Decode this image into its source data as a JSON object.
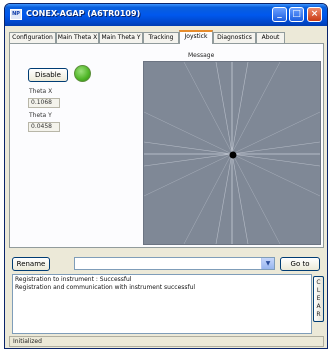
{
  "window": {
    "title": "CONEX-AGAP (A6TR0109)",
    "icon_text": "NP"
  },
  "title_buttons": {
    "minimize": "_",
    "maximize": "□",
    "close": "×"
  },
  "tabs": [
    {
      "label": "Configuration",
      "active": false
    },
    {
      "label": "Main Theta X",
      "active": false
    },
    {
      "label": "Main Theta Y",
      "active": false
    },
    {
      "label": "Tracking",
      "active": false
    },
    {
      "label": "Joystick",
      "active": true
    },
    {
      "label": "Diagnostics",
      "active": false
    },
    {
      "label": "About",
      "active": false
    }
  ],
  "joystick": {
    "disable_label": "Disable",
    "status_color": "#4fb526",
    "theta_x_label": "Theta X",
    "theta_x_value": "0.1068",
    "theta_y_label": "Theta Y",
    "theta_y_value": "0.0458",
    "message_label": "Message",
    "pad_color": "#7f8896",
    "line_color": "#c9ced8",
    "cursor_color": "#000000"
  },
  "command": {
    "rename_label": "Rename",
    "value": "",
    "goto_label": "Go to"
  },
  "log": {
    "lines": [
      "Registration to instrument : Successful",
      "Registration and communication with instrument successful"
    ],
    "clear_label": "CLEAR"
  },
  "status": {
    "text": "Initialized"
  }
}
